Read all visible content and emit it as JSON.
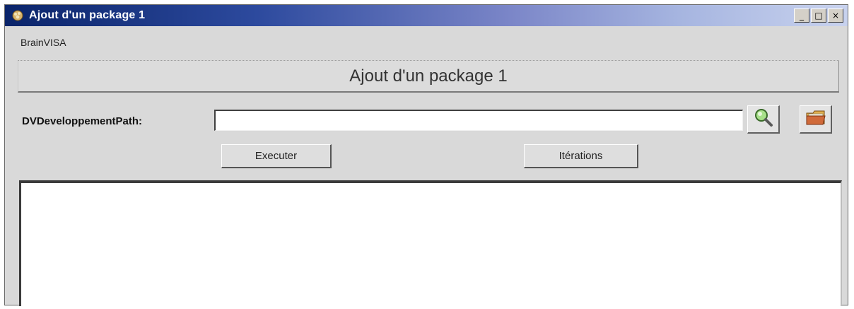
{
  "window": {
    "title": "Ajout d'un package 1",
    "minimize_label": "_",
    "maximize_label": "□",
    "close_label": "×"
  },
  "menubar": {
    "label": "BrainVISA"
  },
  "header": {
    "title": "Ajout d'un package 1"
  },
  "form": {
    "field_label": "DVDeveloppementPath:",
    "field_value": "",
    "browse_icon": "magnifier-icon",
    "open_icon": "folder-icon"
  },
  "actions": {
    "execute_label": "Executer",
    "iterations_label": "Itérations"
  },
  "log": {
    "content": ""
  },
  "colors": {
    "titlebar_start": "#0a246a",
    "titlebar_end": "#c8d2ee",
    "window_bg": "#d9d9d9"
  }
}
